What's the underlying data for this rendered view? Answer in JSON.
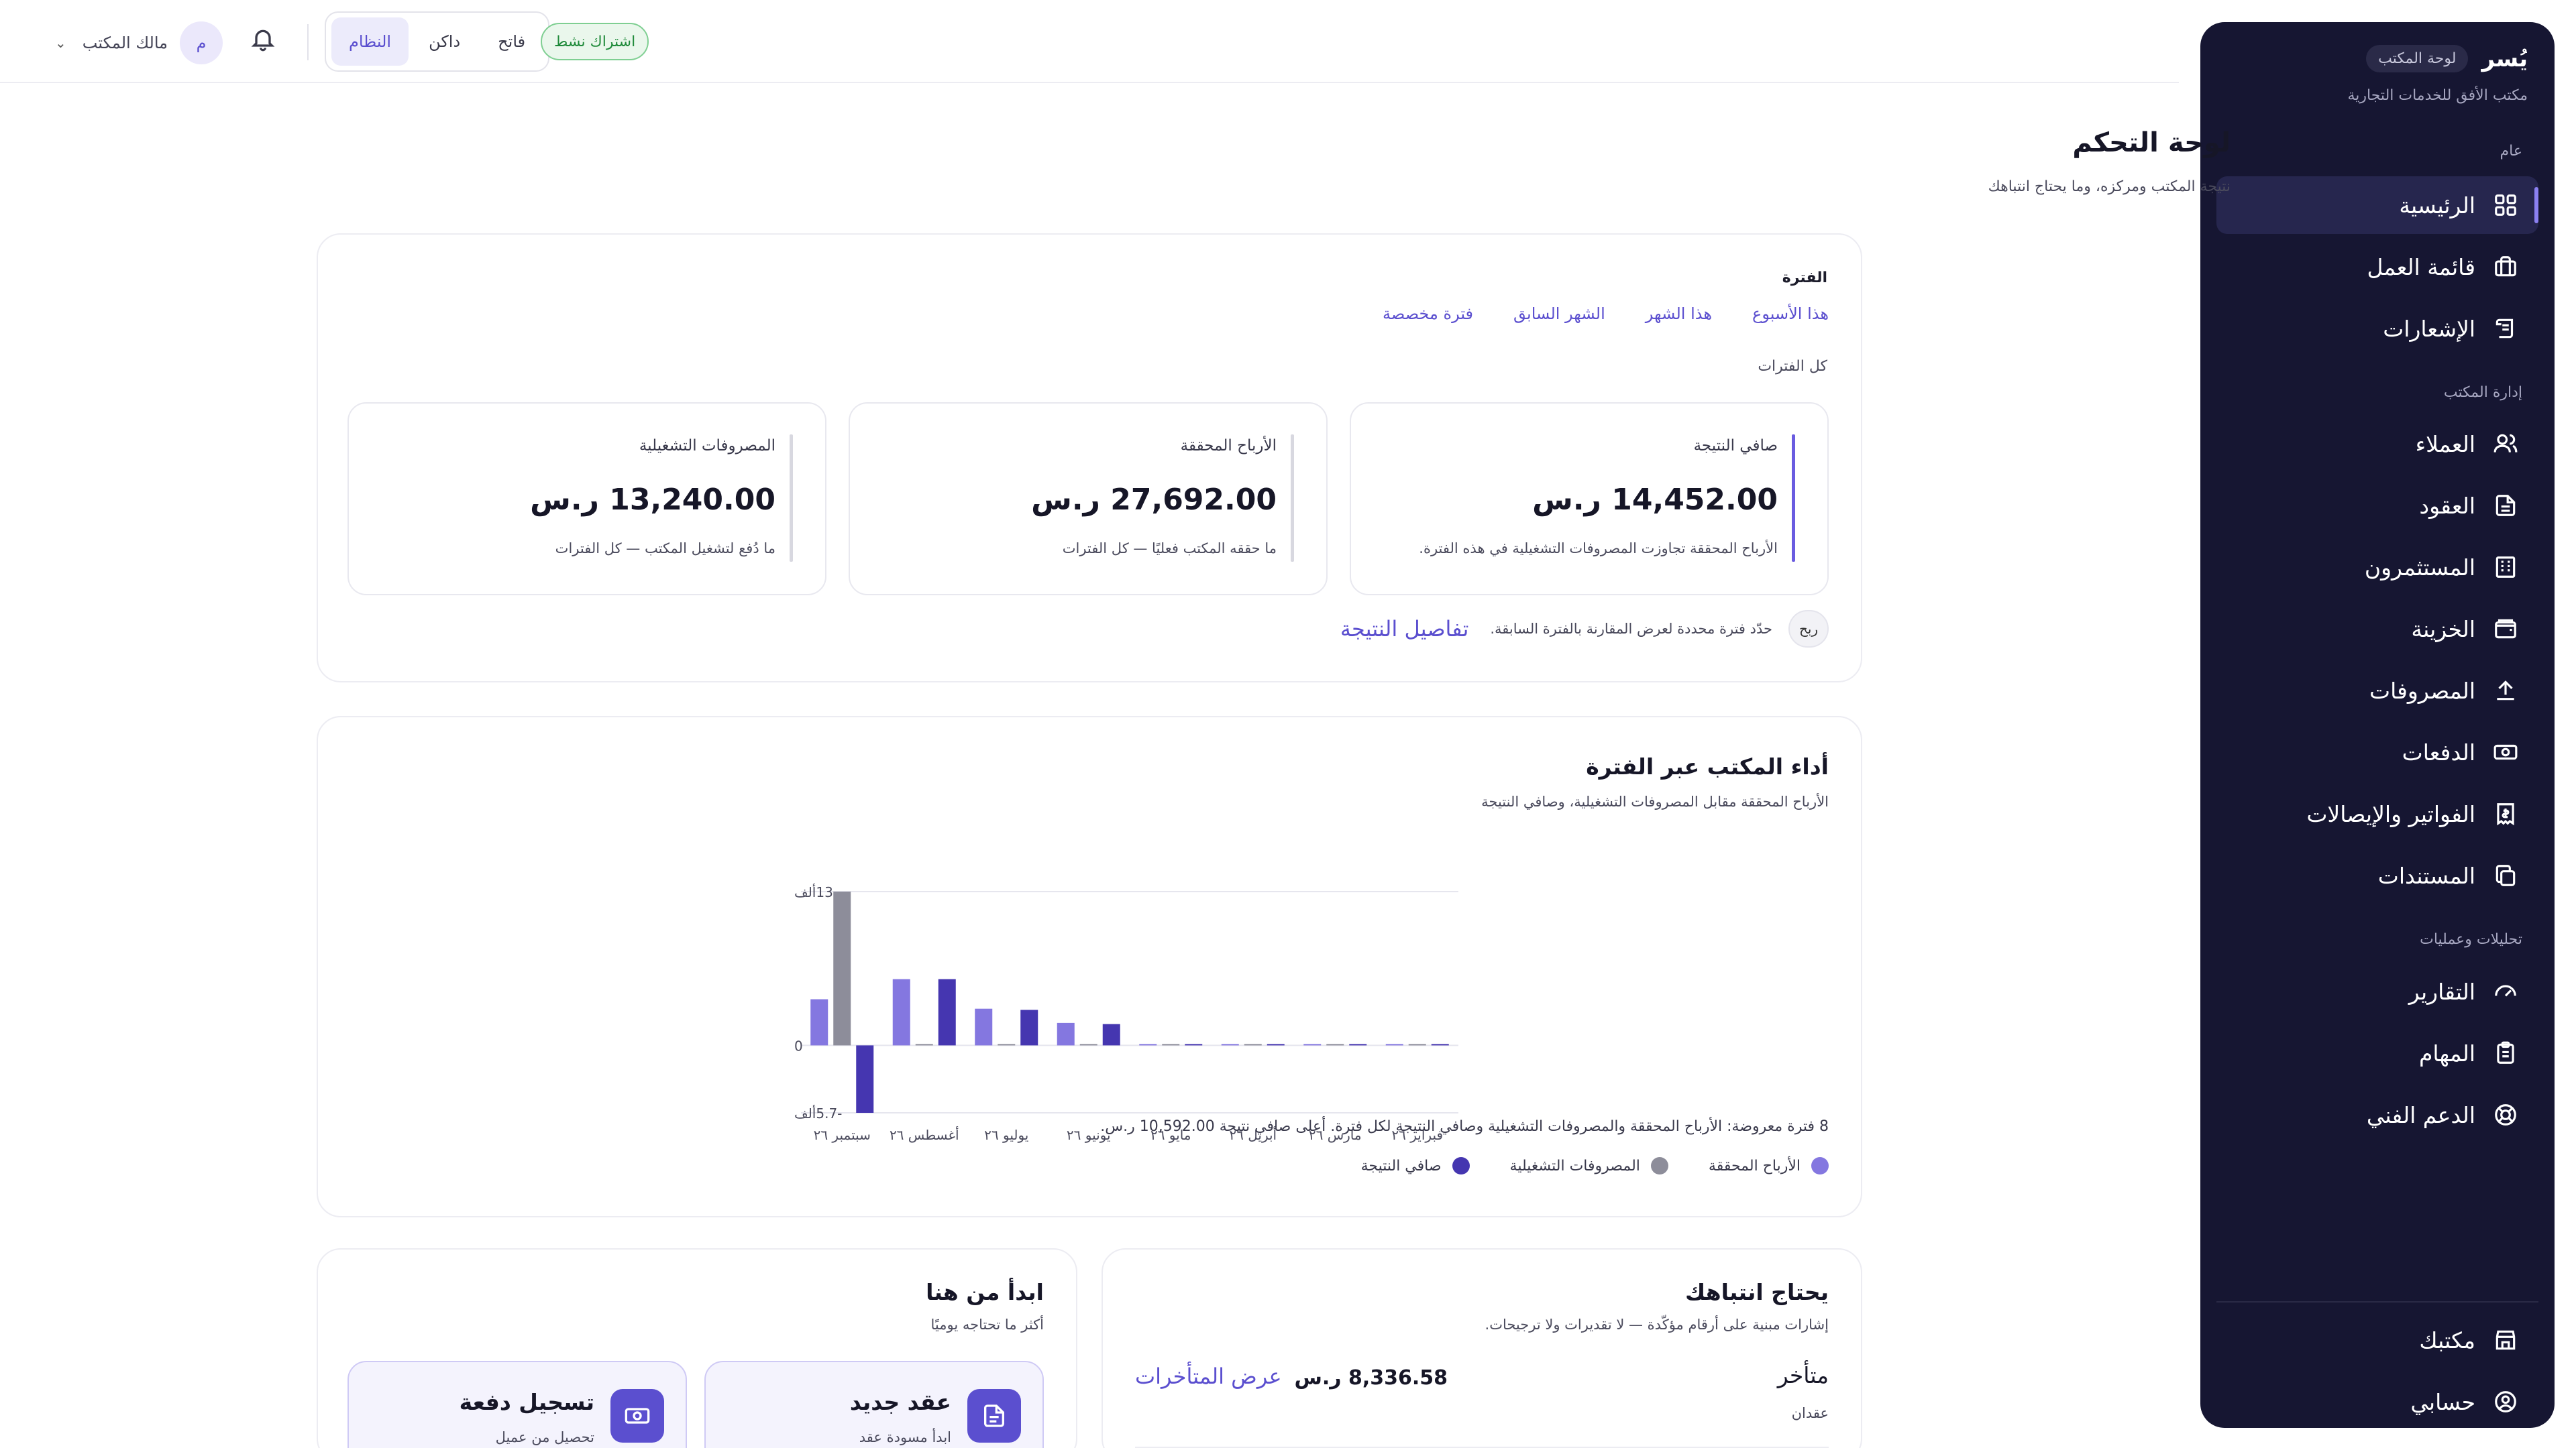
{
  "sidebar": {
    "brand": "يُسر",
    "pill": "لوحة المكتب",
    "office_name": "مكتب الأفق للخدمات التجارية",
    "sections": {
      "general": "عام",
      "office_management": "إدارة المكتب",
      "analytics": "تحليلات وعمليات"
    },
    "items": {
      "home": "الرئيسية",
      "worklist": "قائمة العمل",
      "notices": "الإشعارات",
      "clients": "العملاء",
      "contracts": "العقود",
      "investors": "المستثمرون",
      "treasury": "الخزينة",
      "expenses": "المصروفات",
      "payments": "الدفعات",
      "invoices": "الفواتير والإيصالات",
      "documents": "المستندات",
      "reports": "التقارير",
      "tasks": "المهام",
      "support": "الدعم الفني",
      "my_office": "مكتبك",
      "my_account": "حسابي"
    }
  },
  "topbar": {
    "avatar_initial": "م",
    "owner": "مالك المكتب",
    "theme_options": [
      "فاتح",
      "داكن",
      "النظام"
    ],
    "subscription": "اشتراك نشط"
  },
  "page": {
    "title": "لوحة التحكم",
    "subtitle": "نتيجة المكتب ومركزه، وما يحتاج انتباهك"
  },
  "period": {
    "label": "الفترة",
    "tabs": [
      "هذا الأسبوع",
      "هذا الشهر",
      "الشهر السابق",
      "فترة مخصصة"
    ],
    "all_periods": "كل الفترات"
  },
  "kpis": {
    "net": {
      "label": "صافي النتيجة",
      "value": "14,452.00 ر.س",
      "note": "الأرباح المحققة تجاوزت المصروفات التشغيلية في هذه الفترة."
    },
    "profits": {
      "label": "الأرباح المحققة",
      "value": "27,692.00 ر.س",
      "note": "ما حققه المكتب فعليًا — كل الفترات"
    },
    "expenses": {
      "label": "المصروفات التشغيلية",
      "value": "13,240.00 ر.س",
      "note": "ما دُفع لتشغيل المكتب — كل الفترات"
    }
  },
  "summary_footer": {
    "badge": "ربح",
    "note": "حدّد فترة محددة لعرض المقارنة بالفترة السابقة.",
    "link": "تفاصيل النتيجة"
  },
  "performance": {
    "title": "أداء المكتب عبر الفترة",
    "subtitle": "الأرباح المحققة مقابل المصروفات التشغيلية، وصافي النتيجة",
    "summary": "8 فترة معروضة: الأرباح المحققة والمصروفات التشغيلية وصافي النتيجة لكل فترة. أعلى صافي نتيجة 10,592.00 ر.س."
  },
  "chart_data": {
    "type": "bar",
    "categories": [
      "فبراير ٢٦",
      "مارس ٢٦",
      "أبريل ٢٦",
      "مايو ٢٦",
      "يونيو ٢٦",
      "يوليو ٢٦",
      "أغسطس ٢٦",
      "سبتمبر ٢٦"
    ],
    "series": [
      {
        "name": "الأرباح المحققة",
        "color": "#8477e0",
        "values": [
          0,
          0,
          0,
          0,
          1900,
          3100,
          5600,
          3900
        ]
      },
      {
        "name": "المصروفات التشغيلية",
        "color": "#8d8d9a",
        "values": [
          0,
          0,
          0,
          0,
          0,
          0,
          0,
          13000
        ]
      },
      {
        "name": "صافي النتيجة",
        "color": "#4536b0",
        "values": [
          0,
          0,
          0,
          0,
          1800,
          3000,
          5600,
          -5700
        ]
      }
    ],
    "y_ticks": [
      "13ألف",
      "0",
      "-5.7ألف"
    ],
    "ylim": [
      -5700,
      13000
    ],
    "grid": true,
    "legend": "bottom-right"
  },
  "attention": {
    "title": "يحتاج انتباهك",
    "subtitle": "إشارات مبنية على أرقام مؤكّدة — لا تقديرات ولا ترجيحات.",
    "row_title": "متأخر",
    "row_sub": "عقدان",
    "amount": "8,336.58 ر.س",
    "link": "عرض المتأخرات"
  },
  "start_here": {
    "title": "ابدأ من هنا",
    "subtitle": "أكثر ما تحتاجه يوميًا",
    "actions": [
      {
        "title": "عقد جديد",
        "sub": "ابدأ مسودة عقد"
      },
      {
        "title": "تسجيل دفعة",
        "sub": "تحصيل من عميل"
      }
    ]
  }
}
